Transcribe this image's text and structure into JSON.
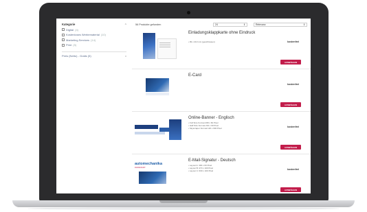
{
  "sidebar": {
    "category_title": "Kategorie",
    "category_toggle": "^",
    "categories": [
      {
        "label": "Digital",
        "count": "(4)"
      },
      {
        "label": "Kostenloses Werbematerial",
        "count": "(10)"
      },
      {
        "label": "Marketing Services",
        "count": "(14)"
      },
      {
        "label": "Print",
        "count": "(5)"
      }
    ],
    "price_label": "Preis (Netto) - Gratis (5)",
    "price_toggle": "v"
  },
  "toolbar": {
    "result_count": "56 Produkte gefunden",
    "per_page": "24",
    "sort": "Relevanz",
    "select_arrow": "⇕"
  },
  "products": [
    {
      "name": "Einladungsklappkarte ohne Eindruck",
      "features": [
        "• 99 x 210 mm (geschlossen)"
      ],
      "status": "kostenfrei",
      "cta": "AUSWÄHLEN"
    },
    {
      "name": "E-Card",
      "features": [],
      "status": "kostenfrei",
      "cta": "AUSWÄHLEN"
    },
    {
      "name": "Online-Banner - Englisch",
      "features": [
        "• Full Size Format 468 x 60 Pixel",
        "• Half Size Format 234 x 60 Pixel",
        "• Skyscraper Format 120 x 600 Pixel"
      ],
      "status": "kostenfrei",
      "cta": "AUSWÄHLEN"
    },
    {
      "name": "E-Mail-Signatur - Deutsch",
      "features": [
        "• Layout A: 300 x 60 Pixel",
        "• Layout B: 470 x 100 Pixel",
        "• Layout C: 600 x 100 Pixel"
      ],
      "status": "kostenfrei",
      "cta": "AUSWÄHLEN",
      "thumb_logo": "automechanika",
      "thumb_subtitle": "FRANKFURT"
    }
  ],
  "colors": {
    "accent": "#c21d4b",
    "link": "#5a6a8a",
    "brand_blue": "#1d3f7e"
  }
}
